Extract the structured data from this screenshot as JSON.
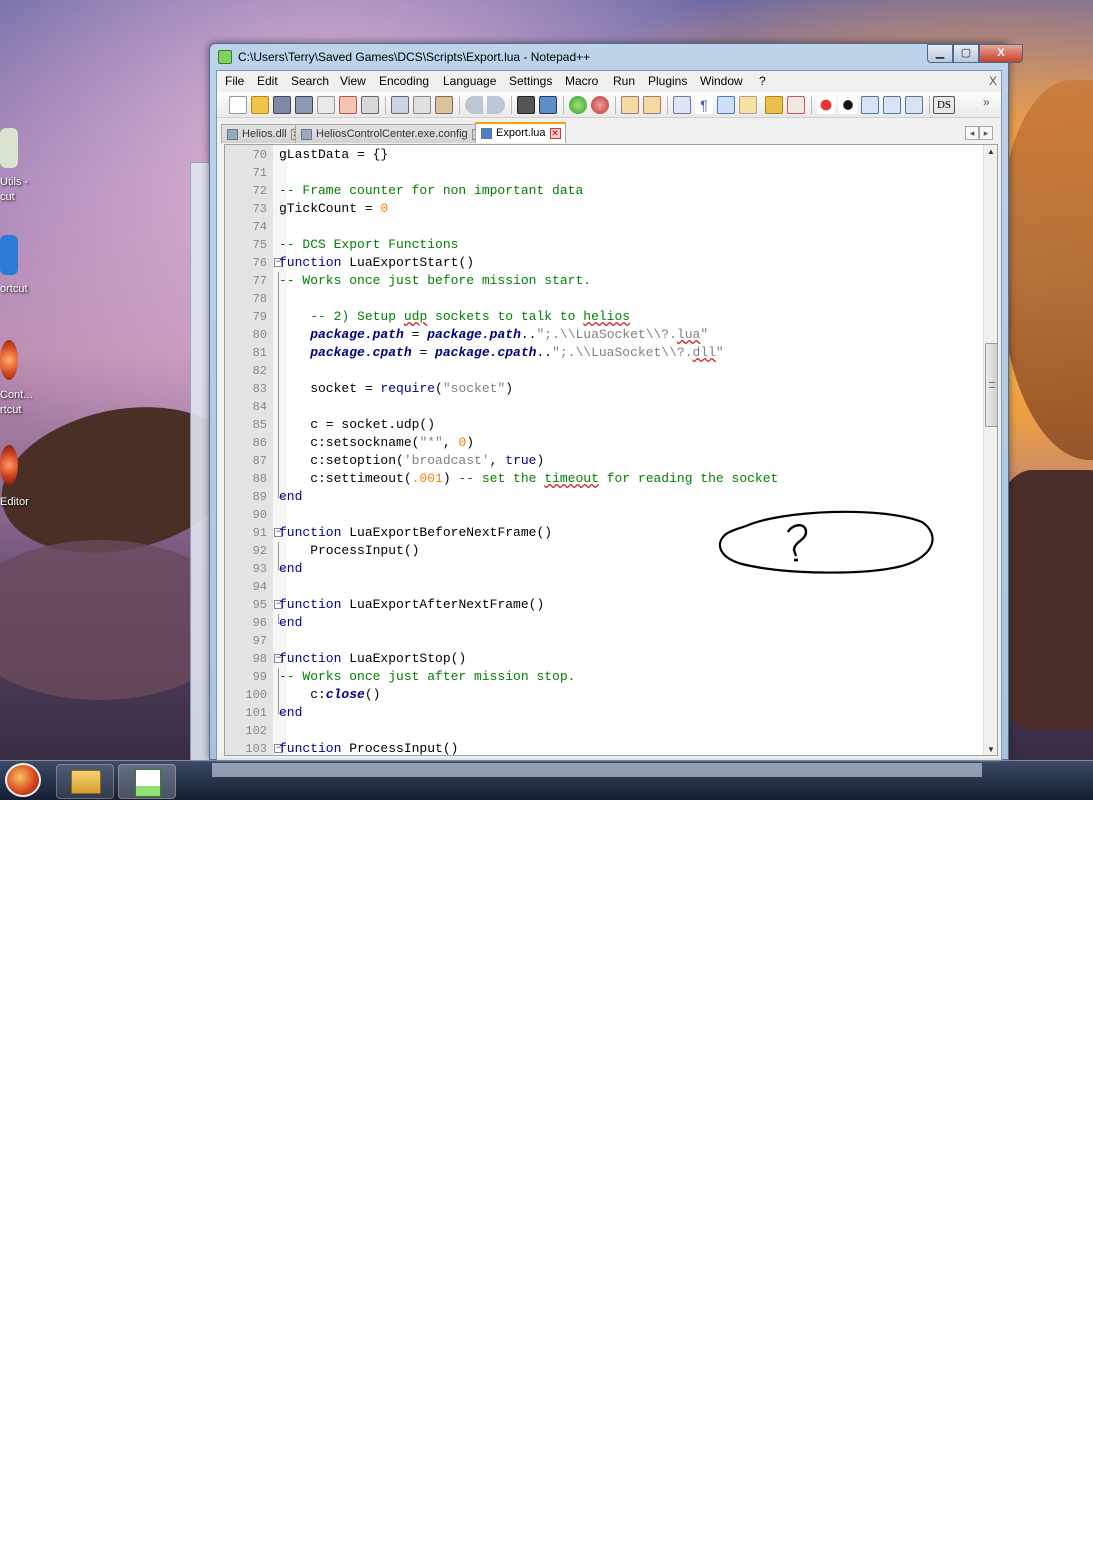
{
  "window": {
    "title": "C:\\Users\\Terry\\Saved Games\\DCS\\Scripts\\Export.lua - Notepad++",
    "minimize": "▁",
    "maximize": "▢",
    "close": "X"
  },
  "menu": {
    "items": [
      "File",
      "Edit",
      "Search",
      "View",
      "Encoding",
      "Language",
      "Settings",
      "Macro",
      "Run",
      "Plugins",
      "Window",
      "?"
    ],
    "close": "X"
  },
  "toolbar": {
    "ds_label": "DS",
    "more": "»"
  },
  "tabs": [
    {
      "label": "Helios.dll",
      "active": false
    },
    {
      "label": "HeliosControlCenter.exe.config",
      "active": false
    },
    {
      "label": "Export.lua",
      "active": true
    }
  ],
  "tab_nav": {
    "left": "◂",
    "right": "▸"
  },
  "desktop_icons": [
    {
      "label": "Utils -",
      "label2": "cut",
      "color": "#d8e3d0"
    },
    {
      "label": "ortcut",
      "label2": "",
      "color": "#2a7ad6"
    },
    {
      "label": "Cont...",
      "label2": "rtcut",
      "color": "#e0572a"
    },
    {
      "label": "Editor",
      "label2": "",
      "color": "#d04424"
    }
  ],
  "code_lines": [
    {
      "n": "70",
      "html": "gLastData = {}"
    },
    {
      "n": "71",
      "html": ""
    },
    {
      "n": "72",
      "html": "<span class='c'>-- Frame counter for non important data</span>"
    },
    {
      "n": "73",
      "html": "gTickCount = <span class='n'>0</span>"
    },
    {
      "n": "74",
      "html": ""
    },
    {
      "n": "75",
      "html": "<span class='c'>-- DCS Export Functions</span>"
    },
    {
      "n": "76",
      "html": "<span class='k'>function</span> LuaExportStart()",
      "fold": "box"
    },
    {
      "n": "77",
      "html": "<span class='c'>-- Works once just before mission start.</span>",
      "fold": "line"
    },
    {
      "n": "78",
      "html": "",
      "fold": "line"
    },
    {
      "n": "79",
      "html": "    <span class='c'>-- 2) Setup <span class='wv'>udp</span> sockets to talk to <span class='wv'>helios</span></span>",
      "fold": "line"
    },
    {
      "n": "80",
      "html": "    <span class='i'>package.path</span> = <span class='i'>package.path</span>..<span class='s'>\";.\\\\LuaSocket\\\\?.<span class='wv'>lua</span>\"</span>",
      "fold": "line"
    },
    {
      "n": "81",
      "html": "    <span class='i'>package.cpath</span> = <span class='i'>package.cpath</span>..<span class='s'>\";.\\\\LuaSocket\\\\?.<span class='wv'>dll</span>\"</span>",
      "fold": "line"
    },
    {
      "n": "82",
      "html": "",
      "fold": "line"
    },
    {
      "n": "83",
      "html": "    socket = <span class='k'>require</span>(<span class='s'>\"socket\"</span>)",
      "fold": "line"
    },
    {
      "n": "84",
      "html": "",
      "fold": "line"
    },
    {
      "n": "85",
      "html": "    c = socket.udp()",
      "fold": "line"
    },
    {
      "n": "86",
      "html": "    c:setsockname(<span class='s'>\"*\"</span>, <span class='n'>0</span>)",
      "fold": "line"
    },
    {
      "n": "87",
      "html": "    c:setoption(<span class='s'>'broadcast'</span>, <span class='k'>true</span>)",
      "fold": "line"
    },
    {
      "n": "88",
      "html": "    c:settimeout(<span class='n'>.001</span>) <span class='c'>-- set the <span class='wv'>timeout</span> for reading the socket</span>",
      "fold": "line"
    },
    {
      "n": "89",
      "html": "<span class='k'>end</span>",
      "fold": "end"
    },
    {
      "n": "90",
      "html": ""
    },
    {
      "n": "91",
      "html": "<span class='k'>function</span> LuaExportBeforeNextFrame()",
      "fold": "box"
    },
    {
      "n": "92",
      "html": "    ProcessInput()",
      "fold": "line"
    },
    {
      "n": "93",
      "html": "<span class='k'>end</span>",
      "fold": "end"
    },
    {
      "n": "94",
      "html": ""
    },
    {
      "n": "95",
      "html": "<span class='k'>function</span> LuaExportAfterNextFrame()",
      "fold": "box"
    },
    {
      "n": "96",
      "html": "<span class='k'>end</span>",
      "fold": "end"
    },
    {
      "n": "97",
      "html": ""
    },
    {
      "n": "98",
      "html": "<span class='k'>function</span> LuaExportStop()",
      "fold": "box"
    },
    {
      "n": "99",
      "html": "<span class='c'>-- Works once just after mission stop.</span>",
      "fold": "line"
    },
    {
      "n": "100",
      "html": "    c:<span class='i'>close</span>()",
      "fold": "line"
    },
    {
      "n": "101",
      "html": "<span class='k'>end</span>",
      "fold": "end"
    },
    {
      "n": "102",
      "html": ""
    },
    {
      "n": "103",
      "html": "<span class='k'>function</span> ProcessInput()",
      "fold": "box"
    }
  ],
  "annotation": {
    "text": "?"
  },
  "colors": {
    "keyword": "#00008b",
    "comment": "#008000",
    "number": "#ff8000",
    "string": "#808080",
    "active_tab_accent": "#f8a000"
  }
}
